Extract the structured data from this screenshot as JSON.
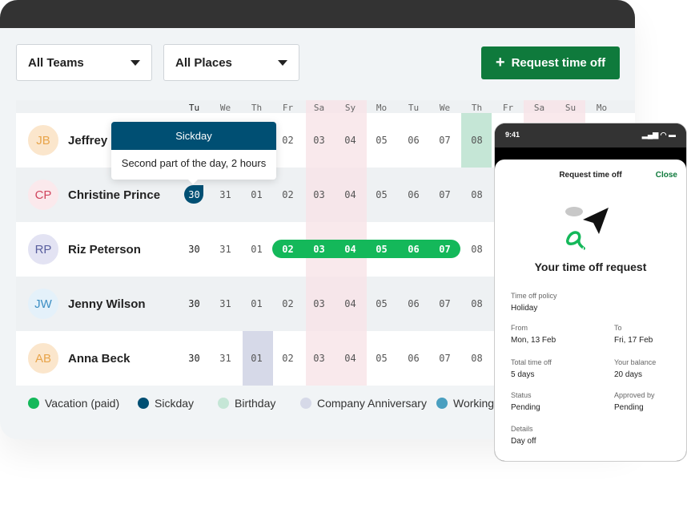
{
  "filters": {
    "teams": "All Teams",
    "places": "All Places"
  },
  "request_button": "Request time off",
  "weekdays": [
    "Tu",
    "We",
    "Th",
    "Fr",
    "Sa",
    "Sy",
    "Mo",
    "Tu",
    "We",
    "Th",
    "Fr",
    "Sa",
    "Su",
    "Mo"
  ],
  "days": [
    "30",
    "31",
    "01",
    "02",
    "03",
    "04",
    "05",
    "06",
    "07",
    "08"
  ],
  "rows": [
    {
      "initials": "JB",
      "name": "Jeffrey",
      "avatar_color": "#e8a44a",
      "avatar_bg": "#fbe6cc"
    },
    {
      "initials": "CP",
      "name": "Christine Prince",
      "avatar_color": "#d0455e",
      "avatar_bg": "#fbe9ec"
    },
    {
      "initials": "RP",
      "name": "Riz Peterson",
      "avatar_color": "#5a5f9e",
      "avatar_bg": "#e3e3f3"
    },
    {
      "initials": "JW",
      "name": "Jenny Wilson",
      "avatar_color": "#3d8fc4",
      "avatar_bg": "#e4f1fa"
    },
    {
      "initials": "AB",
      "name": "Anna Beck",
      "avatar_color": "#e8a44a",
      "avatar_bg": "#fbe6cc"
    }
  ],
  "tooltip": {
    "title": "Sickday",
    "body": "Second part of the day, 2 hours"
  },
  "legend": [
    {
      "label": "Vacation (paid)",
      "color": "#14b85a"
    },
    {
      "label": "Sickday",
      "color": "#004f73"
    },
    {
      "label": "Birthday",
      "color": "#c5e6d6"
    },
    {
      "label": "Company Anniversary",
      "color": "#d6d9e8"
    },
    {
      "label": "Working",
      "color": "#4a9fc0"
    }
  ],
  "phone": {
    "time": "9:41",
    "header": "Request time off",
    "close": "Close",
    "title": "Your time off request",
    "fields": [
      {
        "label": "Time off policy",
        "value": "Holiday"
      },
      {
        "label": "From",
        "value": "Mon, 13 Feb"
      },
      {
        "label": "To",
        "value": "Fri, 17 Feb"
      },
      {
        "label": "Total time off",
        "value": "5 days"
      },
      {
        "label": "Your balance",
        "value": "20 days"
      },
      {
        "label": "Status",
        "value": "Pending"
      },
      {
        "label": "Approved by",
        "value": "Pending"
      },
      {
        "label": "Details",
        "value": "Day off"
      }
    ]
  }
}
